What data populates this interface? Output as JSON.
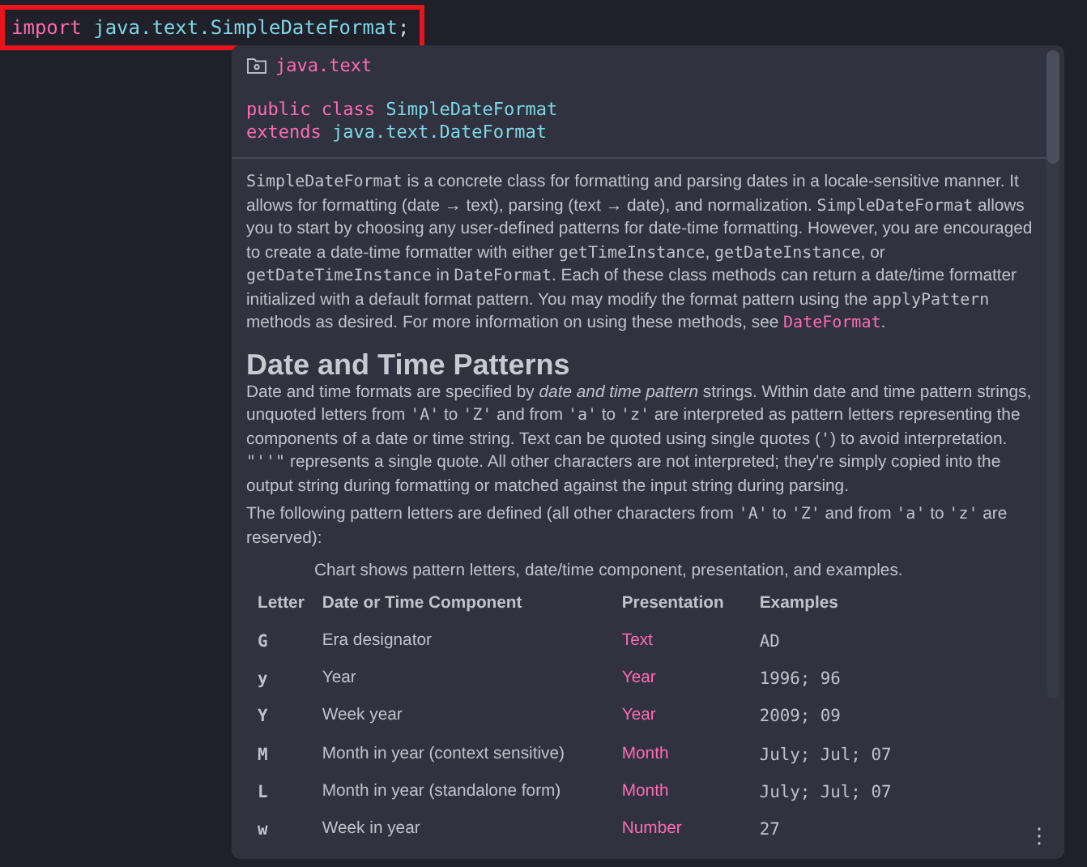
{
  "editor": {
    "line": [
      {
        "kind": "keyword",
        "text": "import"
      },
      {
        "kind": "ident",
        "text": "java.text.SimpleDateFormat"
      },
      {
        "kind": "punct",
        "text": ";"
      }
    ],
    "highlighted": true
  },
  "popup": {
    "package": "java.text",
    "signature": [
      [
        {
          "kind": "keyword",
          "text": "public class"
        },
        {
          "kind": "ident",
          "text": "SimpleDateFormat"
        }
      ],
      [
        {
          "kind": "keyword",
          "text": "extends"
        },
        {
          "kind": "ident",
          "text": "java.text.DateFormat"
        }
      ]
    ],
    "intro": [
      {
        "kind": "code",
        "text": "SimpleDateFormat"
      },
      {
        "kind": "text",
        "text": " is a concrete class for formatting and parsing dates in a locale-sensitive manner. It allows for formatting (date → text), parsing (text → date), and normalization. "
      },
      {
        "kind": "code",
        "text": "SimpleDateFormat"
      },
      {
        "kind": "text",
        "text": " allows you to start by choosing any user-defined patterns for date-time formatting. However, you are encouraged to create a date-time formatter with either "
      },
      {
        "kind": "code",
        "text": "getTimeInstance"
      },
      {
        "kind": "text",
        "text": ", "
      },
      {
        "kind": "code",
        "text": "getDateInstance"
      },
      {
        "kind": "text",
        "text": ", or "
      },
      {
        "kind": "code",
        "text": "getDateTimeInstance"
      },
      {
        "kind": "text",
        "text": " in "
      },
      {
        "kind": "code",
        "text": "DateFormat"
      },
      {
        "kind": "text",
        "text": ". Each of these class methods can return a date/time formatter initialized with a default format pattern. You may modify the format pattern using the "
      },
      {
        "kind": "code",
        "text": "applyPattern"
      },
      {
        "kind": "text",
        "text": " methods as desired. For more information on using these methods, see "
      },
      {
        "kind": "link",
        "text": "DateFormat"
      },
      {
        "kind": "text",
        "text": "."
      }
    ],
    "heading": "Date and Time Patterns",
    "paragraphs": [
      [
        {
          "kind": "text",
          "text": "Date and time formats are specified by *date and time pattern* strings. Within date and time pattern strings, unquoted letters from "
        },
        {
          "kind": "code",
          "text": "'A'"
        },
        {
          "kind": "text",
          "text": " to "
        },
        {
          "kind": "code",
          "text": "'Z'"
        },
        {
          "kind": "text",
          "text": " and from "
        },
        {
          "kind": "code",
          "text": "'a'"
        },
        {
          "kind": "text",
          "text": " to "
        },
        {
          "kind": "code",
          "text": "'z'"
        },
        {
          "kind": "text",
          "text": " are interpreted as pattern letters representing the components of a date or time string. Text can be quoted using single quotes ("
        },
        {
          "kind": "code",
          "text": "'"
        },
        {
          "kind": "text",
          "text": ") to avoid interpretation. "
        },
        {
          "kind": "code",
          "text": "\"''\""
        },
        {
          "kind": "text",
          "text": " represents a single quote. All other characters are not interpreted; they're simply copied into the output string during formatting or matched against the input string during parsing."
        }
      ],
      [
        {
          "kind": "text",
          "text": "The following pattern letters are defined (all other characters from "
        },
        {
          "kind": "code",
          "text": "'A'"
        },
        {
          "kind": "text",
          "text": " to "
        },
        {
          "kind": "code",
          "text": "'Z'"
        },
        {
          "kind": "text",
          "text": " and from "
        },
        {
          "kind": "code",
          "text": "'a'"
        },
        {
          "kind": "text",
          "text": " to "
        },
        {
          "kind": "code",
          "text": "'z'"
        },
        {
          "kind": "text",
          "text": " are reserved):"
        }
      ]
    ],
    "table": {
      "caption": "Chart shows pattern letters, date/time component, presentation, and examples.",
      "columns": [
        "Letter",
        "Date or Time Component",
        "Presentation",
        "Examples"
      ],
      "rows": [
        [
          "G",
          "Era designator",
          "Text",
          "AD"
        ],
        [
          "y",
          "Year",
          "Year",
          "1996; 96"
        ],
        [
          "Y",
          "Week year",
          "Year",
          "2009; 09"
        ],
        [
          "M",
          "Month in year (context sensitive)",
          "Month",
          "July; Jul; 07"
        ],
        [
          "L",
          "Month in year (standalone form)",
          "Month",
          "July; Jul; 07"
        ],
        [
          "w",
          "Week in year",
          "Number",
          "27"
        ]
      ]
    },
    "more_button": "⋮"
  }
}
